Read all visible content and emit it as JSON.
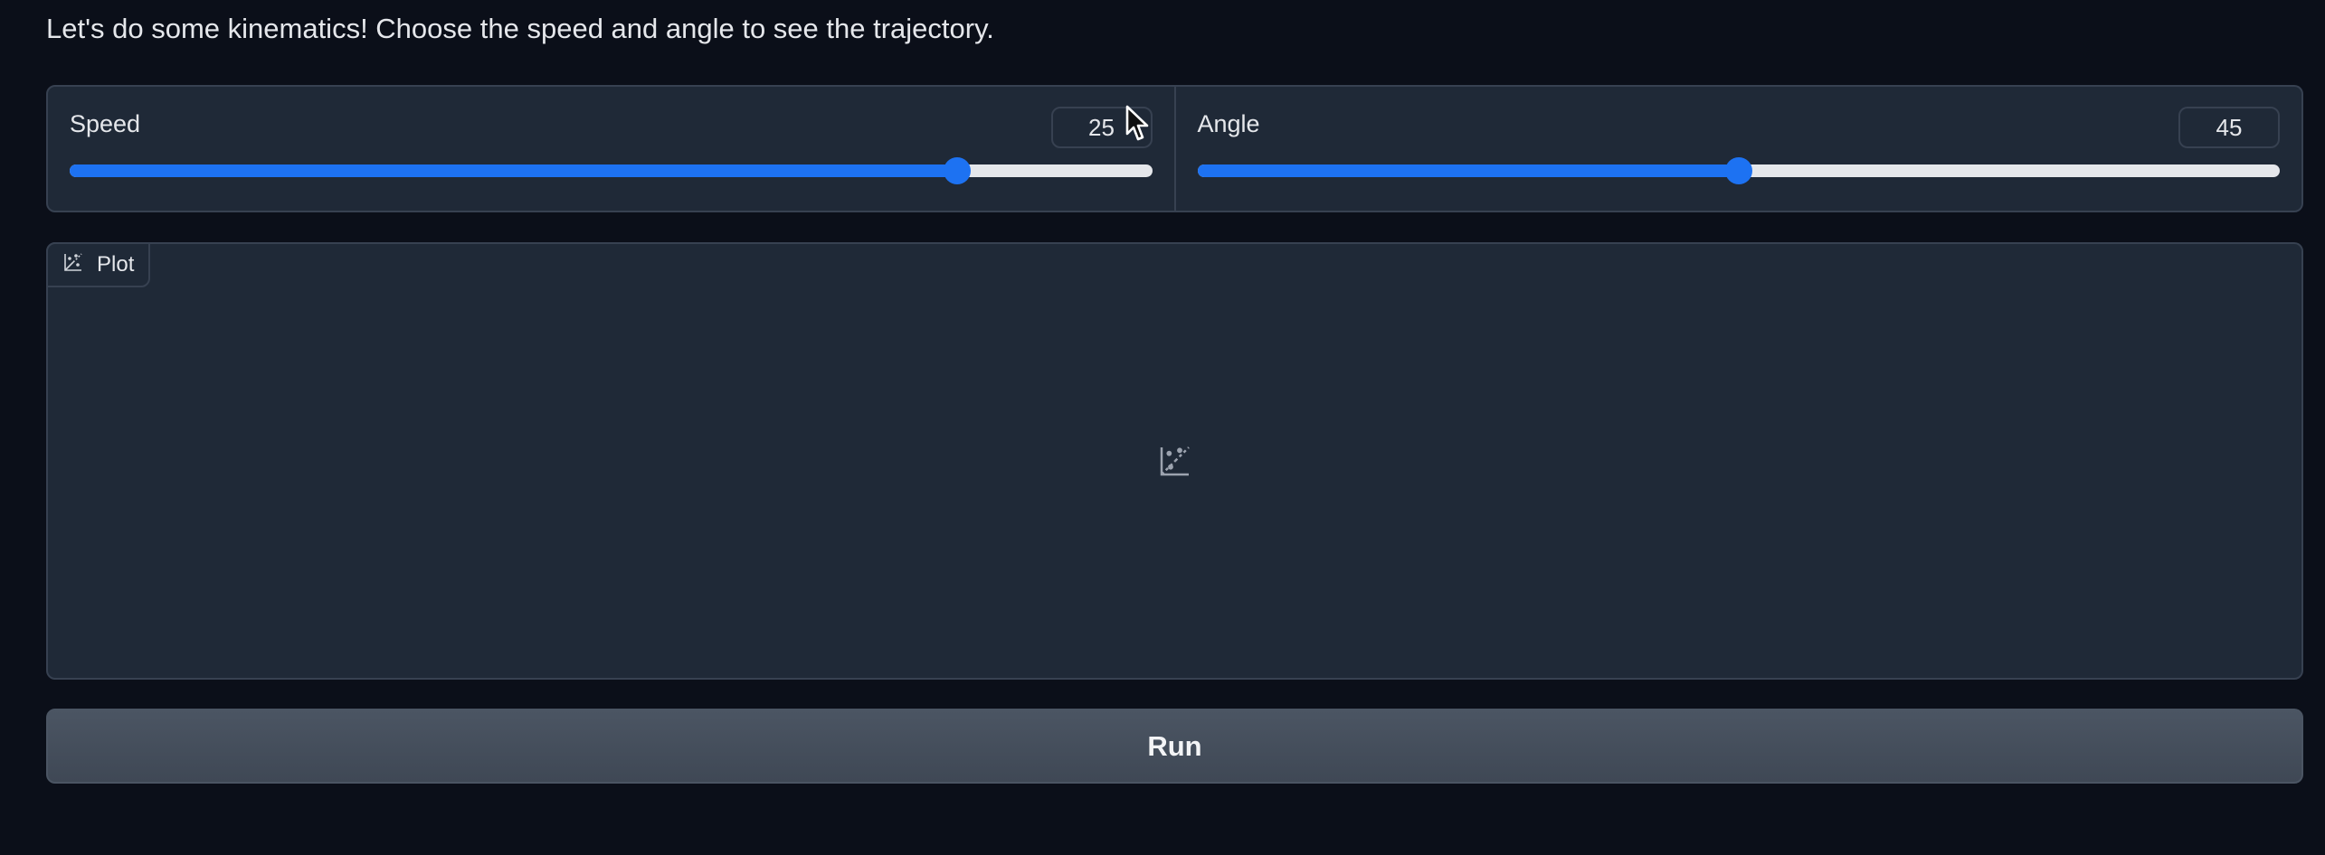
{
  "intro_text": "Let's do some kinematics! Choose the speed and angle to see the trajectory.",
  "sliders": {
    "speed": {
      "label": "Speed",
      "value": "25",
      "fill_fraction": 0.82
    },
    "angle": {
      "label": "Angle",
      "value": "45",
      "fill_fraction": 0.5
    }
  },
  "plot": {
    "label": "Plot",
    "icon": "chart-icon"
  },
  "run_button": {
    "label": "Run"
  },
  "colors": {
    "background": "#0b0f19",
    "panel": "#1f2937",
    "border": "#374151",
    "accent": "#1d72f2",
    "track": "#e5e7eb"
  }
}
